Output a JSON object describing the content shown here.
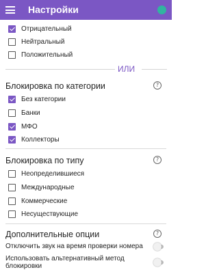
{
  "app_bar": {
    "title": "Настройки",
    "menu_icon": "hamburger-icon",
    "status_icon": "status-dot-icon"
  },
  "rating_filter": {
    "items": [
      {
        "label": "Отрицательный",
        "checked": true
      },
      {
        "label": "Нейтральный",
        "checked": false
      },
      {
        "label": "Положительный",
        "checked": false
      }
    ]
  },
  "or_divider": {
    "label": "ИЛИ"
  },
  "category_block": {
    "title": "Блокировка по категории",
    "help_icon": "help-icon",
    "items": [
      {
        "label": "Без категории",
        "checked": true
      },
      {
        "label": "Банки",
        "checked": false
      },
      {
        "label": "МФО",
        "checked": true
      },
      {
        "label": "Коллекторы",
        "checked": true
      }
    ]
  },
  "type_block": {
    "title": "Блокировка по типу",
    "help_icon": "help-icon",
    "items": [
      {
        "label": "Неопределившиеся",
        "checked": false
      },
      {
        "label": "Международные",
        "checked": false
      },
      {
        "label": "Коммерческие",
        "checked": false
      },
      {
        "label": "Несуществующие",
        "checked": false
      }
    ]
  },
  "extra_options": {
    "title": "Дополнительные опции",
    "help_icon": "help-icon",
    "items": [
      {
        "label": "Отключить звук на время проверки номера",
        "enabled": false
      },
      {
        "label": "Использовать альтернативный метод блокировки",
        "enabled": false
      }
    ]
  },
  "colors": {
    "accent": "#7b57c4",
    "status_dot": "#31b4a0"
  }
}
